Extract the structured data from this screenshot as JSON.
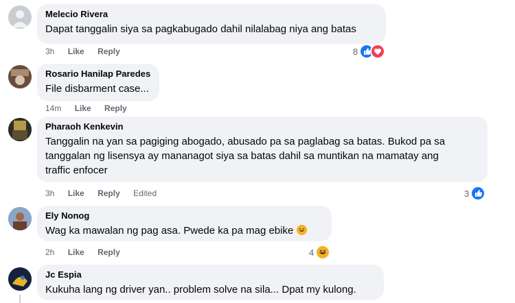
{
  "comments": [
    {
      "author": "Melecio Rivera",
      "text": "Dapat tanggalin siya sa pagkabugado dahil nilalabag niya ang batas",
      "time": "3h",
      "like": "Like",
      "reply": "Reply",
      "edited": "",
      "reaction_count": "8",
      "reactions": [
        "like-icon",
        "heart-icon"
      ],
      "avatar_color": "#c9ccd1"
    },
    {
      "author": "Rosario Hanilap Paredes",
      "text": "File disbarment case...",
      "time": "14m",
      "like": "Like",
      "reply": "Reply",
      "edited": "",
      "reaction_count": "",
      "reactions": [],
      "avatar_color": "#7a5a48"
    },
    {
      "author": "Pharaoh Kenkevin",
      "text_lines": [
        "Tanggalin na yan sa pagiging abogado, abusado pa sa paglabag sa batas. Bukod pa sa",
        "tanggalan ng lisensya ay mananagot siya sa batas dahil sa muntikan na mamatay ang",
        "traffic enfocer"
      ],
      "time": "3h",
      "like": "Like",
      "reply": "Reply",
      "edited": "Edited",
      "reaction_count": "3",
      "reactions": [
        "like-icon"
      ],
      "avatar_color": "#3b3a30"
    },
    {
      "author": "Ely Nonog",
      "text": "Wag ka mawalan ng pag asa. Pwede ka pa mag ebike",
      "time": "2h",
      "like": "Like",
      "reply": "Reply",
      "edited": "",
      "reaction_count": "4",
      "reactions": [
        "haha-icon"
      ],
      "avatar_color": "#6f8db5"
    },
    {
      "author": "Jc Espia",
      "text": "Kukuha lang ng driver yan.. problem solve na sila... Dpat my kulong.",
      "time": "",
      "like": "",
      "reply": "",
      "edited": "",
      "reaction_count": "",
      "reactions": [],
      "avatar_color": "#1b2a4a"
    }
  ],
  "colors": {
    "bubble": "#f0f2f5",
    "meta_text": "#65676b",
    "like_blue": "#1877f2",
    "heart_red": "#f33e58",
    "haha_yellow": "#f7b125"
  }
}
